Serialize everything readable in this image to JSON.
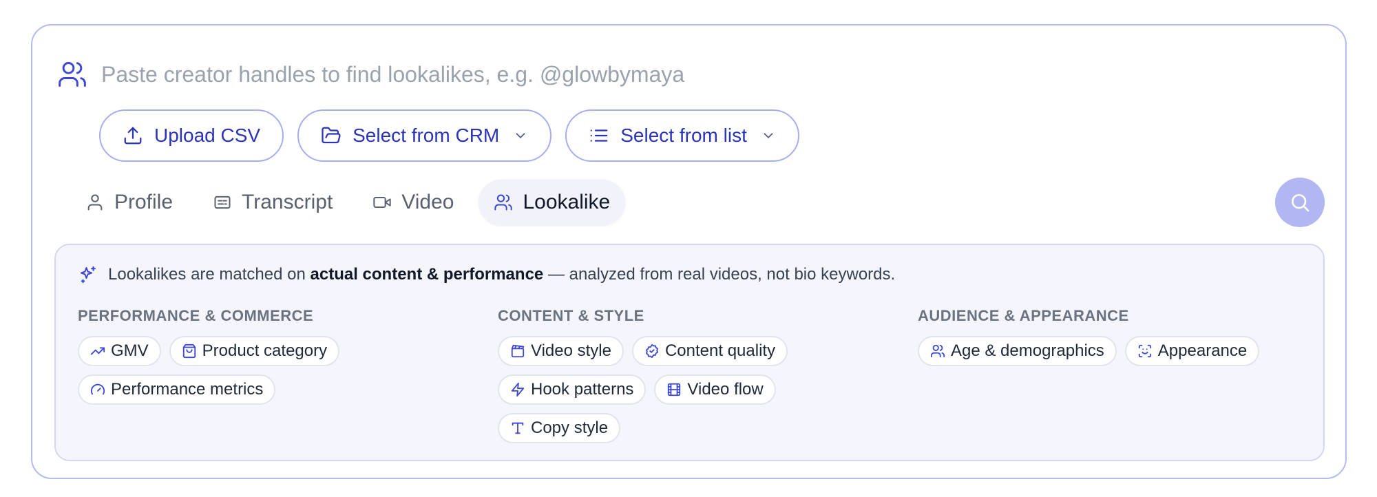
{
  "search": {
    "placeholder": "Paste creator handles to find lookalikes, e.g. @glowbymaya",
    "value": ""
  },
  "sources": {
    "upload_csv": "Upload CSV",
    "select_crm": "Select from CRM",
    "select_list": "Select from list"
  },
  "tabs": [
    {
      "label": "Profile",
      "icon": "user-icon"
    },
    {
      "label": "Transcript",
      "icon": "transcript-icon"
    },
    {
      "label": "Video",
      "icon": "video-icon"
    },
    {
      "label": "Lookalike",
      "icon": "users-icon",
      "active": true
    }
  ],
  "info": {
    "prefix": "Lookalikes are matched on",
    "bold": "actual content & performance",
    "suffix": "— analyzed from real videos, not bio keywords."
  },
  "categories": [
    {
      "title": "PERFORMANCE & COMMERCE",
      "chips": [
        {
          "label": "GMV",
          "icon": "trending-up-icon"
        },
        {
          "label": "Product category",
          "icon": "shopping-bag-icon"
        },
        {
          "label": "Performance metrics",
          "icon": "gauge-icon"
        }
      ]
    },
    {
      "title": "CONTENT & STYLE",
      "chips": [
        {
          "label": "Video style",
          "icon": "clapperboard-icon"
        },
        {
          "label": "Content quality",
          "icon": "badge-check-icon"
        },
        {
          "label": "Hook patterns",
          "icon": "zap-icon"
        },
        {
          "label": "Video flow",
          "icon": "film-icon"
        },
        {
          "label": "Copy style",
          "icon": "type-icon"
        }
      ]
    },
    {
      "title": "AUDIENCE & APPEARANCE",
      "chips": [
        {
          "label": "Age & demographics",
          "icon": "users-icon"
        },
        {
          "label": "Appearance",
          "icon": "scan-face-icon"
        }
      ]
    }
  ],
  "colors": {
    "accent": "#3b46d6",
    "border": "#b4bbf2",
    "panel_bg": "#f5f6fd",
    "search_button": "#b2b7f3"
  }
}
